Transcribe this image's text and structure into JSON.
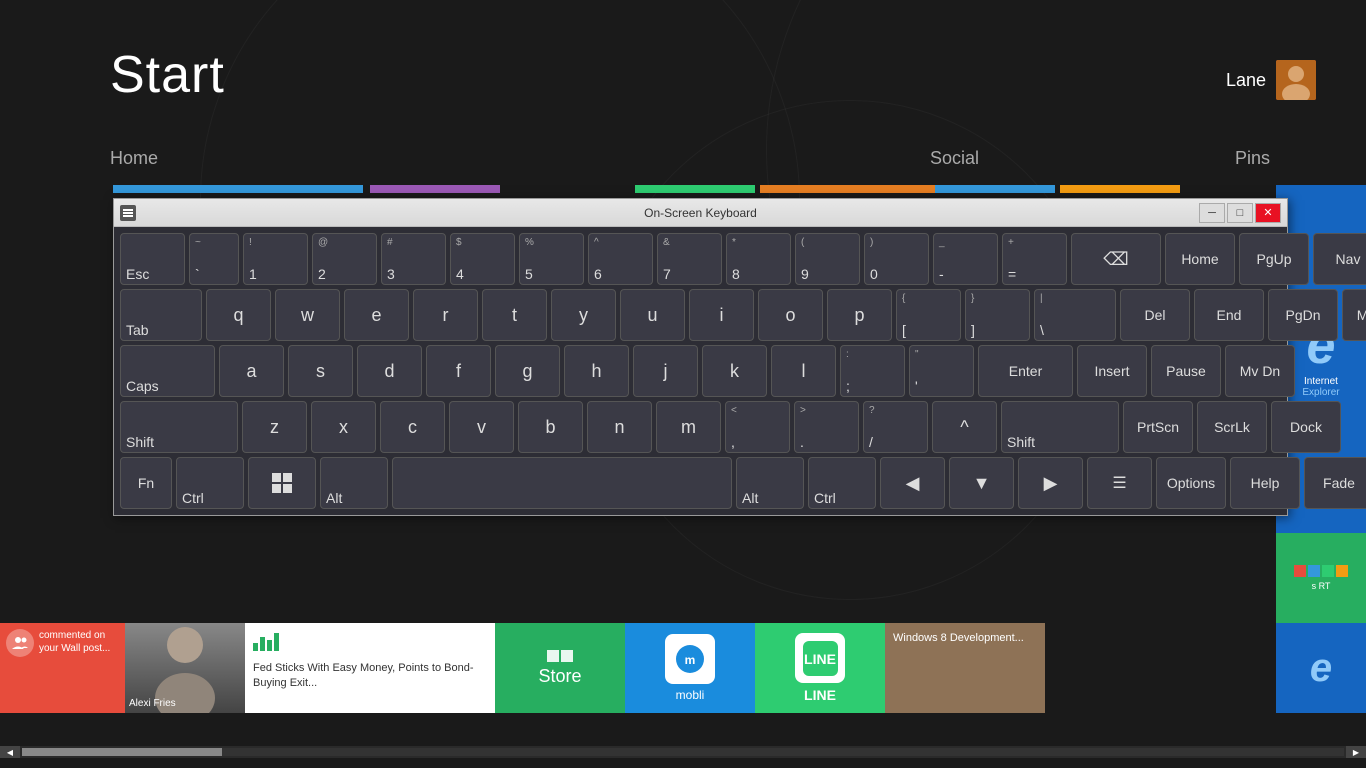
{
  "page": {
    "title": "Start",
    "bg_color": "#1a1a1a"
  },
  "header": {
    "start_label": "Start",
    "user_name": "Lane",
    "sections": [
      "Home",
      "Social",
      "Pins"
    ]
  },
  "osk": {
    "title": "On-Screen Keyboard",
    "rows": [
      {
        "keys": [
          {
            "label": "Esc",
            "sub": ""
          },
          {
            "label": "`",
            "sub": "~"
          },
          {
            "label": "1",
            "sub": "!"
          },
          {
            "label": "2",
            "sub": "@"
          },
          {
            "label": "3",
            "sub": "#"
          },
          {
            "label": "4",
            "sub": "$"
          },
          {
            "label": "5",
            "sub": "%"
          },
          {
            "label": "6",
            "sub": "^"
          },
          {
            "label": "7",
            "sub": "&"
          },
          {
            "label": "8",
            "sub": "*"
          },
          {
            "label": "9",
            "sub": "("
          },
          {
            "label": "0",
            "sub": ")"
          },
          {
            "label": "-",
            "sub": "_"
          },
          {
            "label": "=",
            "sub": "+"
          },
          {
            "label": "⌫",
            "sub": ""
          },
          {
            "label": "Home",
            "sub": ""
          },
          {
            "label": "PgUp",
            "sub": ""
          },
          {
            "label": "Nav",
            "sub": ""
          }
        ]
      },
      {
        "keys": [
          {
            "label": "Tab",
            "sub": ""
          },
          {
            "label": "q",
            "sub": ""
          },
          {
            "label": "w",
            "sub": ""
          },
          {
            "label": "e",
            "sub": ""
          },
          {
            "label": "r",
            "sub": ""
          },
          {
            "label": "t",
            "sub": ""
          },
          {
            "label": "y",
            "sub": ""
          },
          {
            "label": "u",
            "sub": ""
          },
          {
            "label": "i",
            "sub": ""
          },
          {
            "label": "o",
            "sub": ""
          },
          {
            "label": "p",
            "sub": ""
          },
          {
            "label": "[",
            "sub": "{"
          },
          {
            "label": "]",
            "sub": "}"
          },
          {
            "label": "\\",
            "sub": "|"
          },
          {
            "label": "Del",
            "sub": ""
          },
          {
            "label": "End",
            "sub": ""
          },
          {
            "label": "PgDn",
            "sub": ""
          },
          {
            "label": "Mv Up",
            "sub": ""
          }
        ]
      },
      {
        "keys": [
          {
            "label": "Caps",
            "sub": ""
          },
          {
            "label": "a",
            "sub": ""
          },
          {
            "label": "s",
            "sub": ""
          },
          {
            "label": "d",
            "sub": ""
          },
          {
            "label": "f",
            "sub": ""
          },
          {
            "label": "g",
            "sub": ""
          },
          {
            "label": "h",
            "sub": ""
          },
          {
            "label": "j",
            "sub": ""
          },
          {
            "label": "k",
            "sub": ""
          },
          {
            "label": "l",
            "sub": ""
          },
          {
            "label": ";",
            "sub": ":"
          },
          {
            "label": "'",
            "sub": "\""
          },
          {
            "label": "Enter",
            "sub": ""
          },
          {
            "label": "Insert",
            "sub": ""
          },
          {
            "label": "Pause",
            "sub": ""
          },
          {
            "label": "Mv Dn",
            "sub": ""
          }
        ]
      },
      {
        "keys": [
          {
            "label": "Shift",
            "sub": ""
          },
          {
            "label": "z",
            "sub": ""
          },
          {
            "label": "x",
            "sub": ""
          },
          {
            "label": "c",
            "sub": ""
          },
          {
            "label": "v",
            "sub": ""
          },
          {
            "label": "b",
            "sub": ""
          },
          {
            "label": "n",
            "sub": ""
          },
          {
            "label": "m",
            "sub": ""
          },
          {
            "label": ",",
            "sub": "<"
          },
          {
            "label": ".",
            "sub": ">"
          },
          {
            "label": "/",
            "sub": "?"
          },
          {
            "label": "^",
            "sub": ""
          },
          {
            "label": "Shift",
            "sub": ""
          },
          {
            "label": "PrtScn",
            "sub": ""
          },
          {
            "label": "ScrLk",
            "sub": ""
          },
          {
            "label": "Dock",
            "sub": ""
          }
        ]
      },
      {
        "keys": [
          {
            "label": "Fn",
            "sub": ""
          },
          {
            "label": "Ctrl",
            "sub": ""
          },
          {
            "label": "⊞",
            "sub": ""
          },
          {
            "label": "Alt",
            "sub": ""
          },
          {
            "label": "",
            "sub": ""
          },
          {
            "label": "Alt",
            "sub": ""
          },
          {
            "label": "Ctrl",
            "sub": ""
          },
          {
            "label": "◀",
            "sub": ""
          },
          {
            "label": "▼",
            "sub": ""
          },
          {
            "label": "▶",
            "sub": ""
          },
          {
            "label": "☰",
            "sub": ""
          },
          {
            "label": "Options",
            "sub": ""
          },
          {
            "label": "Help",
            "sub": ""
          },
          {
            "label": "Fade",
            "sub": ""
          }
        ]
      }
    ]
  },
  "tiles": {
    "facebook_text": "commented on your Wall post...",
    "person_name": "Alexi Fries",
    "news_headline": "Fed Sticks With Easy Money, Points to Bond-Buying Exit...",
    "store_label": "Store",
    "mobli_label": "mobli",
    "line_label": "LINE",
    "win8_label": "Windows 8 Development..."
  },
  "window_controls": {
    "minimize": "─",
    "maximize": "□",
    "close": "✕"
  }
}
